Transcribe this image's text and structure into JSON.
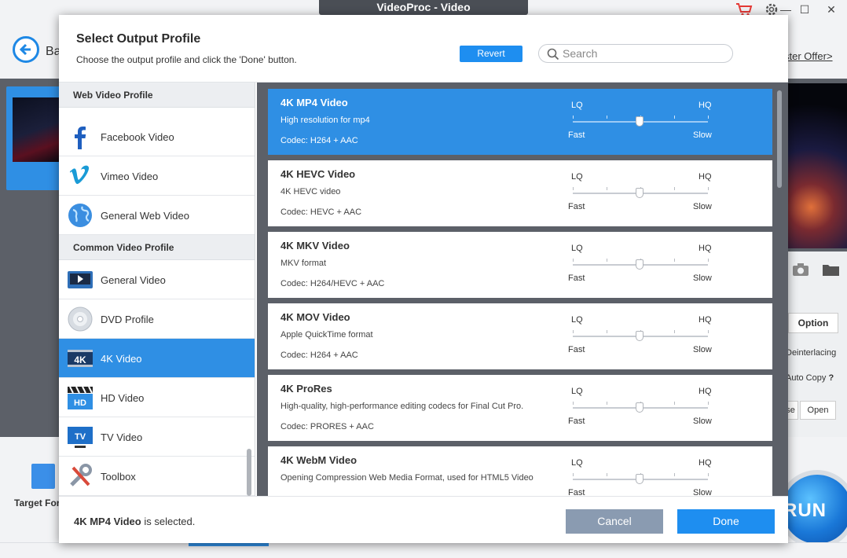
{
  "app": {
    "title": "VideoProc - Video",
    "back_label": "Ba",
    "offer_link": "ster Offer>",
    "option_label": "Option",
    "deinterlacing_label": "Deinterlacing",
    "auto_copy_label": "Auto Copy",
    "auto_copy_help": "?",
    "browse_partial_label": "se",
    "open_label": "Open",
    "target_format_label": "Target For",
    "run_label": "RUN"
  },
  "dialog": {
    "title": "Select Output Profile",
    "subtitle": "Choose the output profile and click the 'Done' button.",
    "revert_label": "Revert",
    "search_placeholder": "Search",
    "footer": {
      "selected_name": "4K MP4 Video",
      "selected_suffix": " is selected.",
      "cancel_label": "Cancel",
      "done_label": "Done"
    }
  },
  "categories": {
    "web_header": "Web Video Profile",
    "common_header": "Common Video Profile",
    "web_items": [
      {
        "label": "Facebook Video",
        "icon": "facebook-icon"
      },
      {
        "label": "Vimeo Video",
        "icon": "vimeo-icon"
      },
      {
        "label": "General Web Video",
        "icon": "globe-icon"
      }
    ],
    "common_items": [
      {
        "label": "General Video",
        "icon": "video-player-icon"
      },
      {
        "label": "DVD Profile",
        "icon": "dvd-disc-icon"
      },
      {
        "label": "4K Video",
        "icon": "4k-icon",
        "selected": true
      },
      {
        "label": "HD Video",
        "icon": "hd-clapper-icon"
      },
      {
        "label": "TV Video",
        "icon": "tv-icon"
      },
      {
        "label": "Toolbox",
        "icon": "toolbox-icon"
      }
    ]
  },
  "quality_labels": {
    "lq": "LQ",
    "hq": "HQ",
    "fast": "Fast",
    "slow": "Slow"
  },
  "profiles": [
    {
      "name": "4K MP4 Video",
      "description": "High resolution for mp4",
      "codec": "Codec: H264 + AAC",
      "selected": true
    },
    {
      "name": "4K HEVC Video",
      "description": "4K HEVC video",
      "codec": "Codec: HEVC + AAC"
    },
    {
      "name": "4K MKV Video",
      "description": "MKV format",
      "codec": "Codec: H264/HEVC + AAC"
    },
    {
      "name": "4K MOV Video",
      "description": "Apple QuickTime format",
      "codec": "Codec: H264 + AAC"
    },
    {
      "name": "4K ProRes",
      "description": "High-quality, high-performance editing codecs for Final Cut Pro.",
      "codec": "Codec: PRORES + AAC"
    },
    {
      "name": "4K WebM Video",
      "description": "Opening Compression Web Media Format, used for HTML5 Video",
      "codec": ""
    }
  ],
  "colors": {
    "accent": "#2f8fe4",
    "button_blue": "#1e8ef0",
    "cancel_gray": "#8a9bb1"
  }
}
